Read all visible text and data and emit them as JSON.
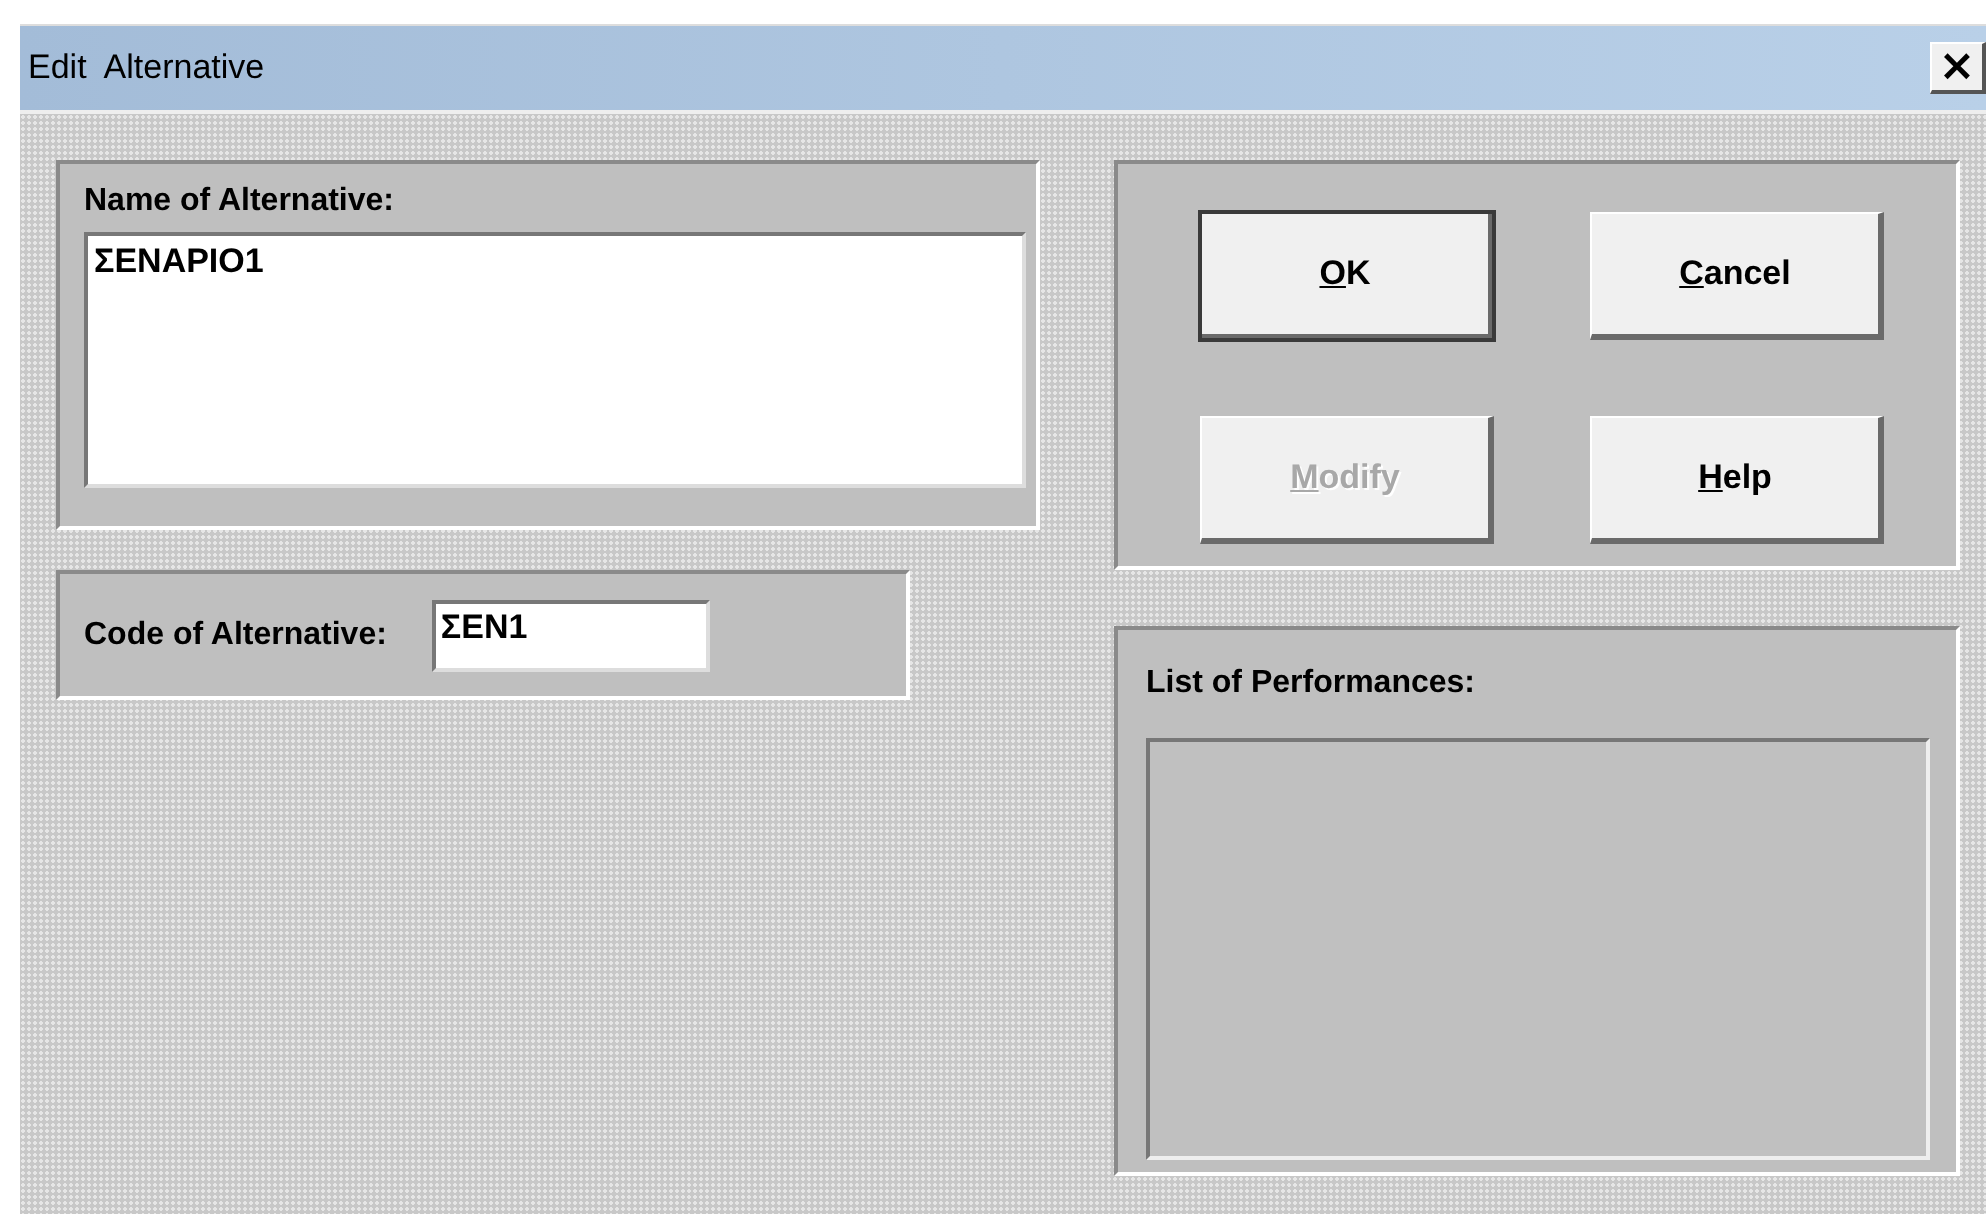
{
  "window": {
    "title": "Edit  Alternative",
    "close_label": "×"
  },
  "name_panel": {
    "label": "Name of Alternative:",
    "value": "ΣΕΝΑΡΙΟ1"
  },
  "code_panel": {
    "label": "Code of Alternative:",
    "value": "ΣΕΝ1"
  },
  "buttons": [
    {
      "label": "OK",
      "default": true,
      "disabled": false
    },
    {
      "label": "Cancel",
      "default": false,
      "disabled": false
    },
    {
      "label": "Modify",
      "default": false,
      "disabled": true
    },
    {
      "label": "Help",
      "default": false,
      "disabled": false
    }
  ],
  "performances": {
    "label": "List of Performances:"
  }
}
